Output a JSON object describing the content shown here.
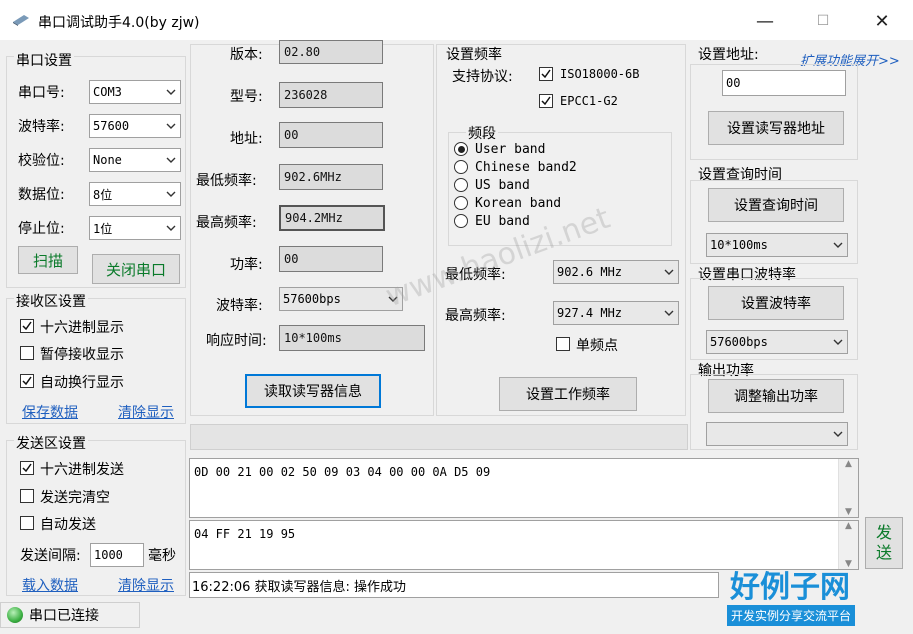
{
  "window": {
    "title": "串口调试助手4.0(by zjw)",
    "minimize": "—",
    "maximize": "☐",
    "close": "✕"
  },
  "serial_settings": {
    "group_title": "串口设置",
    "port_label": "串口号:",
    "port_value": "COM3",
    "baud_label": "波特率:",
    "baud_value": "57600",
    "parity_label": "校验位:",
    "parity_value": "None",
    "data_label": "数据位:",
    "data_value": "8位",
    "stop_label": "停止位:",
    "stop_value": "1位",
    "scan_button": "扫描",
    "close_port_button": "关闭串口"
  },
  "receive_settings": {
    "group_title": "接收区设置",
    "hex_display": "十六进制显示",
    "hex_display_checked": true,
    "pause_display": "暂停接收显示",
    "pause_display_checked": false,
    "auto_newline": "自动换行显示",
    "auto_newline_checked": true,
    "save_link": "保存数据",
    "clear_link": "清除显示"
  },
  "send_settings": {
    "group_title": "发送区设置",
    "hex_send": "十六进制发送",
    "hex_send_checked": true,
    "clear_after_send": "发送完清空",
    "clear_after_send_checked": false,
    "auto_send": "自动发送",
    "auto_send_checked": false,
    "interval_label": "发送间隔:",
    "interval_value": "1000",
    "interval_unit": "毫秒",
    "load_link": "载入数据",
    "clear_link": "清除显示"
  },
  "reader_info": {
    "version_label": "版本:",
    "version_value": "02.80",
    "model_label": "型号:",
    "model_value": "236028",
    "address_label": "地址:",
    "address_value": "00",
    "min_freq_label": "最低频率:",
    "min_freq_value": "902.6MHz",
    "max_freq_label": "最高频率:",
    "max_freq_value": "904.2MHz",
    "power_label": "功率:",
    "power_value": "00",
    "baud_label": "波特率:",
    "baud_value": "57600bps",
    "response_label": "响应时间:",
    "response_value": "10*100ms",
    "read_button": "读取读写器信息"
  },
  "frequency": {
    "group_title": "设置频率",
    "protocol_label": "支持协议:",
    "protocol_1": "ISO18000-6B",
    "protocol_1_checked": true,
    "protocol_2": "EPCC1-G2",
    "protocol_2_checked": true,
    "band_title": "频段",
    "bands": [
      "User band",
      "Chinese band2",
      "US band",
      "Korean band",
      "EU band"
    ],
    "selected_band": "User band",
    "min_freq_label": "最低频率:",
    "min_freq_value": "902.6 MHz",
    "max_freq_label": "最高频率:",
    "max_freq_value": "927.4 MHz",
    "single_point": "单频点",
    "single_point_checked": false,
    "set_button": "设置工作频率"
  },
  "right_panel": {
    "address_title": "设置地址:",
    "expand_link": "扩展功能展开>>",
    "address_value": "00",
    "set_address_button": "设置读写器地址",
    "query_title": "设置查询时间",
    "set_query_button": "设置查询时间",
    "query_value": "10*100ms",
    "baud_title": "设置串口波特率",
    "set_baud_button": "设置波特率",
    "baud_value": "57600bps",
    "power_title": "输出功率",
    "set_power_button": "调整输出功率",
    "power_value": ""
  },
  "receive_text": "0D 00 21 00 02 50 09 03 04 00 00 0A D5 09",
  "send_text": "04 FF 21 19 95",
  "send_button": "发送",
  "log_text": "16:22:06 获取读写器信息: 操作成功",
  "status_text": "串口已连接",
  "watermark": {
    "url": "www.haolizi.net",
    "brand": "好例子网",
    "slogan": "开发实例分享交流平台"
  },
  "colors": {
    "accent": "#0078d7",
    "link": "#1f5fbf",
    "status_led": "#3cb043",
    "watermark": "#1a8fd8"
  }
}
